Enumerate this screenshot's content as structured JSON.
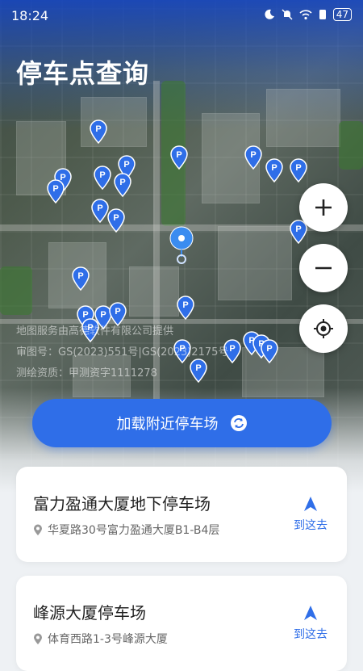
{
  "status_bar": {
    "time": "18:24",
    "battery": "47"
  },
  "page": {
    "title": "停车点查询"
  },
  "map": {
    "attribution_lines": [
      "地图服务由高德软件有限公司提供",
      "审图号：GS(2023)551号|GS(2023)2175号",
      "测绘资质：甲测资字1111278"
    ],
    "controls": {
      "zoom_in_label": "+",
      "zoom_out_label": "−"
    }
  },
  "load_button": {
    "label": "加载附近停车场"
  },
  "parking_list": [
    {
      "name": "富力盈通大厦地下停车场",
      "address": "华夏路30号富力盈通大厦B1-B4层",
      "navigate_label": "到这去"
    },
    {
      "name": "峰源大厦停车场",
      "address": "体育西路1-3号峰源大厦",
      "navigate_label": "到这去"
    }
  ],
  "colors": {
    "accent": "#2f6ee8",
    "pin": "#2f6ee8"
  }
}
